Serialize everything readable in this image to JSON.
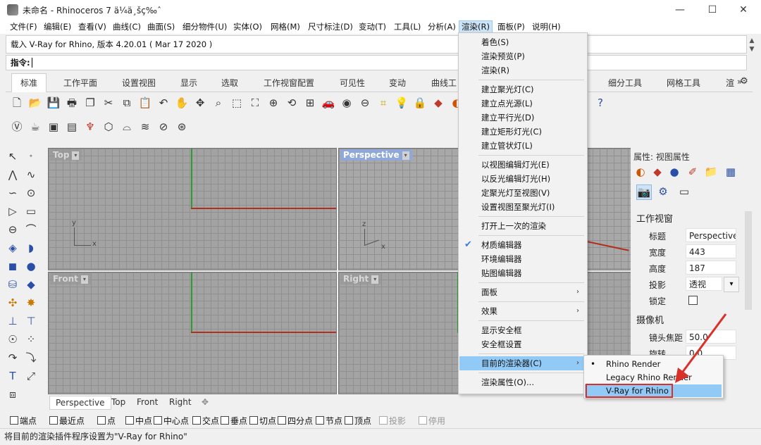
{
  "window": {
    "title": "未命名 - Rhinoceros 7 ä¼ä¸šç‰ˆ",
    "minimize": "—",
    "maximize": "☐",
    "close": "✕"
  },
  "menubar": [
    "文件(F)",
    "编辑(E)",
    "查看(V)",
    "曲线(C)",
    "曲面(S)",
    "细分物件(U)",
    "实体(O)",
    "网格(M)",
    "尺寸标注(D)",
    "变动(T)",
    "工具(L)",
    "分析(A)",
    "渲染(R)",
    "面板(P)",
    "说明(H)"
  ],
  "command": {
    "history": "载入 V-Ray for Rhino, 版本 4.20.01 ( Mar 17 2020 )",
    "prompt": "指令:"
  },
  "toolbar_tabs": [
    "标准",
    "工作平面",
    "设置视图",
    "显示",
    "选取",
    "工作视窗配置",
    "可见性",
    "变动",
    "曲线工",
    "细分工具",
    "网格工具",
    "渲"
  ],
  "toolbar_more": "»",
  "viewports": {
    "top": "Top",
    "perspective": "Perspective",
    "front": "Front",
    "right": "Right",
    "axis_x": "x",
    "axis_y": "y",
    "axis_z": "z"
  },
  "viewport_tabs": [
    "Perspective",
    "Top",
    "Front",
    "Right"
  ],
  "viewport_tab_add": "✥",
  "osnap": [
    {
      "label": "端点",
      "enabled": true
    },
    {
      "label": "最近点",
      "enabled": true
    },
    {
      "label": "点",
      "enabled": true
    },
    {
      "label": "中点",
      "enabled": true
    },
    {
      "label": "中心点",
      "enabled": true
    },
    {
      "label": "交点",
      "enabled": true
    },
    {
      "label": "垂点",
      "enabled": true
    },
    {
      "label": "切点",
      "enabled": true
    },
    {
      "label": "四分点",
      "enabled": true
    },
    {
      "label": "节点",
      "enabled": true
    },
    {
      "label": "顶点",
      "enabled": true
    },
    {
      "label": "投影",
      "enabled": false
    },
    {
      "label": "停用",
      "enabled": false
    }
  ],
  "status": "将目前的渲染插件程序设置为\"V-Ray for Rhino\"",
  "properties": {
    "title": "属性: 视图属性",
    "section_viewport": "工作视窗",
    "rows": [
      {
        "label": "标题",
        "value": "Perspective"
      },
      {
        "label": "宽度",
        "value": "443"
      },
      {
        "label": "高度",
        "value": "187"
      },
      {
        "label": "投影",
        "value": "透视"
      },
      {
        "label": "锁定",
        "value": ""
      }
    ],
    "section_camera": "摄像机",
    "camera_rows": [
      {
        "label": "镜头焦距",
        "value": "50.0"
      },
      {
        "label": "旋转",
        "value": "0.0"
      }
    ]
  },
  "render_menu": {
    "items": [
      {
        "label": "着色(S)"
      },
      {
        "label": "渲染预览(P)"
      },
      {
        "label": "渲染(R)"
      },
      {
        "sep": true
      },
      {
        "label": "建立聚光灯(C)"
      },
      {
        "label": "建立点光源(L)"
      },
      {
        "label": "建立平行光(D)"
      },
      {
        "label": "建立矩形灯光(C)"
      },
      {
        "label": "建立管状灯(L)"
      },
      {
        "sep": true
      },
      {
        "label": "以视图编辑灯光(E)"
      },
      {
        "label": "以反光编辑灯光(H)"
      },
      {
        "label": "定聚光灯至视图(V)"
      },
      {
        "label": "设置视图至聚光灯(I)"
      },
      {
        "sep": true
      },
      {
        "label": "打开上一次的渲染"
      },
      {
        "sep": true
      },
      {
        "label": "材质编辑器",
        "checked": true
      },
      {
        "label": "环境编辑器"
      },
      {
        "label": "贴图编辑器"
      },
      {
        "sep": true
      },
      {
        "label": "面板",
        "submenu": true
      },
      {
        "sep": true
      },
      {
        "label": "效果",
        "submenu": true
      },
      {
        "sep": true
      },
      {
        "label": "显示安全框"
      },
      {
        "label": "安全框设置"
      },
      {
        "sep": true
      },
      {
        "label": "目前的渲染器(C)",
        "submenu": true,
        "highlighted": true
      },
      {
        "sep": true
      },
      {
        "label": "渲染属性(O)..."
      }
    ],
    "check_mark": "✔",
    "arrow": "›"
  },
  "renderer_submenu": [
    {
      "label": "Rhino Render",
      "current": true
    },
    {
      "label": "Legacy Rhino Render"
    },
    {
      "label": "V-Ray for Rhino",
      "highlighted": true
    }
  ],
  "bullet": "•",
  "colors": {
    "menu_highlight": "#91c9f7",
    "annotation_red": "#d9302a",
    "viewport_bg": "#a3a3a3",
    "active_viewport_label": "#8fa7d9"
  }
}
